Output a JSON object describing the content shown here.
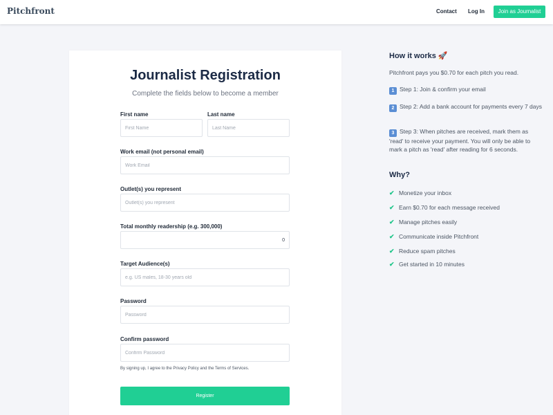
{
  "nav": {
    "logo": "Pitchfront",
    "contact": "Contact",
    "login": "Log In",
    "join": "Join as Journalist"
  },
  "form": {
    "title": "Journalist Registration",
    "subtitle": "Complete the fields below to become a member",
    "first_name_label": "First name",
    "first_name_placeholder": "First Name",
    "last_name_label": "Last name",
    "last_name_placeholder": "Last Name",
    "email_label": "Work email (not personal email)",
    "email_placeholder": "Work Email",
    "outlet_label": "Outlet(s) you represent",
    "outlet_placeholder": "Outlet(s) you represent",
    "readership_label": "Total monthly readership (e.g. 300,000)",
    "readership_value": "0",
    "audience_label": "Target Audience(s)",
    "audience_placeholder": "e.g. US males, 18-30 years old",
    "password_label": "Password",
    "password_placeholder": "Password",
    "confirm_label": "Confirm password",
    "confirm_placeholder": "Confirm Password",
    "terms": "By signing up, I agree to the Privacy Policy and the Terms of Services.",
    "register": "Register"
  },
  "sidebar": {
    "how_title": "How it works 🚀",
    "intro": "Pitchfront pays you $0.70 for each pitch you read.",
    "steps": [
      {
        "num": "1",
        "text": "Step 1: Join & confirm your email"
      },
      {
        "num": "2",
        "text": "Step 2: Add a bank account for payments every 7 days"
      },
      {
        "num": "3",
        "text": "Step 3: When pitches are received, mark them as 'read' to receive your payment. You will only be able to mark a pitch as 'read' after reading for 6 seconds."
      }
    ],
    "why_title": "Why?",
    "why": [
      "Monetize your inbox",
      "Earn $0.70 for each message received",
      "Manage pitches easily",
      "Communicate inside Pitchfront",
      "Reduce spam pitches",
      "Get started in 10 minutes"
    ],
    "check_glyph": "✔"
  },
  "colors": {
    "accent": "#20cf94",
    "heading": "#1b2a45",
    "background": "#f4f5f9"
  }
}
